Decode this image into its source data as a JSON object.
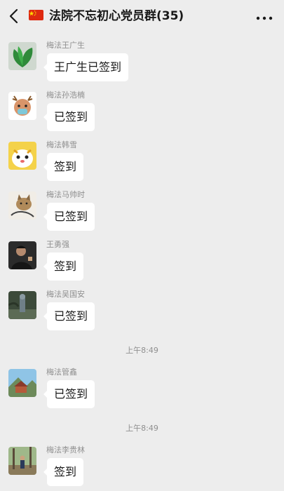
{
  "header": {
    "title": "法院不忘初心党员群(35)",
    "back_icon": "chevron-left-icon",
    "more_icon": "more-dots-icon",
    "flag_icon": "china-flag-icon"
  },
  "messages": [
    {
      "sender": "梅法王广生",
      "text": "王广生已签到",
      "avatar": "plant-avatar"
    },
    {
      "sender": "梅法孙浩楠",
      "text": "已签到",
      "avatar": "deer-avatar"
    },
    {
      "sender": "梅法韩雪",
      "text": "签到",
      "avatar": "cartoon-character-avatar"
    },
    {
      "sender": "梅法马帅时",
      "text": "已签到",
      "avatar": "cat-avatar"
    },
    {
      "sender": "王勇强",
      "text": "签到",
      "avatar": "photo-avatar"
    },
    {
      "sender": "梅法吴国安",
      "text": "已签到",
      "avatar": "photo-avatar"
    },
    {
      "sender": "梅法管鑫",
      "text": "已签到",
      "avatar": "landscape-avatar"
    },
    {
      "sender": "梅法李贵林",
      "text": "签到",
      "avatar": "photo-avatar"
    }
  ],
  "timestamps": [
    "上午8:49",
    "上午8:49"
  ]
}
